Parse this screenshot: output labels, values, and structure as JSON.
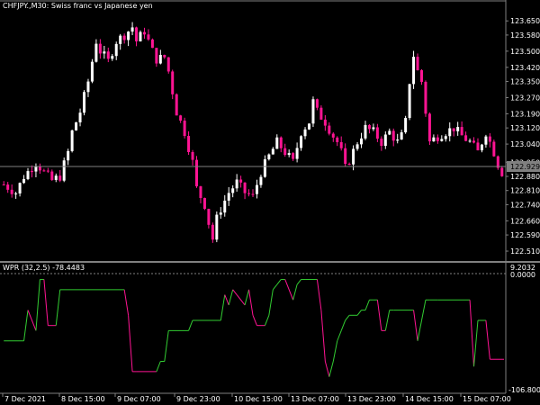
{
  "main_chart": {
    "header": "CHFJPY.,M30:  Swiss franc vs Japanese yen",
    "y_ticks": [
      "123.650",
      "123.580",
      "123.500",
      "123.420",
      "123.350",
      "123.270",
      "123.190",
      "123.120",
      "123.040",
      "122.950",
      "122.880",
      "122.810",
      "122.740",
      "122.660",
      "122.590",
      "122.510"
    ],
    "y_tick_values": [
      123.65,
      123.58,
      123.5,
      123.42,
      123.35,
      123.27,
      123.19,
      123.12,
      123.04,
      122.95,
      122.88,
      122.81,
      122.74,
      122.66,
      122.59,
      122.51
    ],
    "price_label": "122.929",
    "price_value": 122.929
  },
  "indicator": {
    "header": "WPR (32,2.5) -78.4483",
    "max_label": "9.2032",
    "level_label": "0.0000",
    "min_label": "-106.8001",
    "y_range": [
      -106.8001,
      9.2032
    ]
  },
  "x_ticks": [
    "7 Dec 2021",
    "8 Dec 15:00",
    "9 Dec 07:00",
    "9 Dec 23:00",
    "10 Dec 15:00",
    "13 Dec 07:00",
    "13 Dec 23:00",
    "14 Dec 15:00",
    "15 Dec 07:00"
  ],
  "colors": {
    "background": "#000000",
    "text": "#ffffff",
    "axis": "#808080",
    "bull_candle": "#ffffff",
    "bear_candle": "#ff1493",
    "wpr_up": "#32cd32",
    "wpr_down": "#ff1493"
  },
  "chart_data": [
    {
      "type": "candlestick",
      "title": "CHFJPY.,M30:  Swiss franc vs Japanese yen",
      "ylim": [
        122.47,
        123.7
      ],
      "current_price": 122.929,
      "close_path": [
        [
          0,
          122.84
        ],
        [
          3,
          122.8
        ],
        [
          5,
          122.88
        ],
        [
          8,
          122.95
        ],
        [
          10,
          122.9
        ],
        [
          12,
          122.86
        ],
        [
          14,
          122.88
        ],
        [
          16,
          123.0
        ],
        [
          17,
          123.1
        ],
        [
          19,
          123.2
        ],
        [
          21,
          123.35
        ],
        [
          23,
          123.55
        ],
        [
          24,
          123.5
        ],
        [
          26,
          123.45
        ],
        [
          28,
          123.55
        ],
        [
          30,
          123.58
        ],
        [
          32,
          123.62
        ],
        [
          33,
          123.55
        ],
        [
          35,
          123.6
        ],
        [
          37,
          123.5
        ],
        [
          38,
          123.46
        ],
        [
          40,
          123.47
        ],
        [
          41,
          123.4
        ],
        [
          43,
          123.2
        ],
        [
          45,
          123.1
        ],
        [
          47,
          122.95
        ],
        [
          48,
          122.82
        ],
        [
          50,
          122.74
        ],
        [
          51,
          122.65
        ],
        [
          52,
          122.57
        ],
        [
          53,
          122.67
        ],
        [
          54,
          122.72
        ],
        [
          56,
          122.8
        ],
        [
          58,
          122.85
        ],
        [
          60,
          122.8
        ],
        [
          62,
          122.78
        ],
        [
          63,
          122.84
        ],
        [
          64,
          122.9
        ],
        [
          66,
          122.98
        ],
        [
          68,
          123.05
        ],
        [
          70,
          123.0
        ],
        [
          72,
          122.95
        ],
        [
          74,
          123.1
        ],
        [
          76,
          123.15
        ],
        [
          77,
          123.25
        ],
        [
          78,
          123.2
        ],
        [
          80,
          123.15
        ],
        [
          82,
          123.08
        ],
        [
          83,
          123.05
        ],
        [
          84,
          123.0
        ],
        [
          85,
          122.92
        ],
        [
          86,
          122.96
        ],
        [
          88,
          123.05
        ],
        [
          90,
          123.12
        ],
        [
          92,
          123.1
        ],
        [
          94,
          123.05
        ],
        [
          96,
          123.1
        ],
        [
          98,
          123.05
        ],
        [
          99,
          123.08
        ],
        [
          100,
          123.15
        ],
        [
          101,
          123.35
        ],
        [
          102,
          123.48
        ],
        [
          103,
          123.4
        ],
        [
          104,
          123.35
        ],
        [
          105,
          123.2
        ],
        [
          106,
          123.05
        ],
        [
          108,
          123.08
        ],
        [
          110,
          123.1
        ],
        [
          112,
          123.12
        ],
        [
          114,
          123.08
        ],
        [
          116,
          123.05
        ],
        [
          118,
          123.0
        ],
        [
          120,
          123.1
        ],
        [
          121,
          123.05
        ],
        [
          122,
          123.0
        ],
        [
          123,
          122.94
        ],
        [
          124,
          122.9
        ]
      ]
    },
    {
      "type": "line",
      "title": "WPR (32,2.5) -78.4483",
      "ylim": [
        -106.8001,
        9.2032
      ],
      "x": [
        0,
        5,
        6,
        8,
        9,
        10,
        11,
        13,
        14,
        30,
        31,
        32,
        33,
        38,
        39,
        40,
        41,
        46,
        47,
        48,
        54,
        55,
        56,
        57,
        58,
        60,
        61,
        62,
        63,
        65,
        66,
        67,
        68,
        69,
        70,
        72,
        73,
        74,
        75,
        78,
        79,
        80,
        81,
        82,
        83,
        84,
        85,
        86,
        88,
        89,
        90,
        91,
        92,
        93,
        94,
        95,
        96,
        97,
        102,
        103,
        104,
        105,
        106,
        108,
        116,
        117,
        118,
        120,
        121
      ],
      "values": [
        -60,
        -60,
        -30,
        -50,
        0,
        0,
        -45,
        -45,
        -10,
        -10,
        -35,
        -90,
        -90,
        -90,
        -80,
        -80,
        -50,
        -50,
        -40,
        -40,
        -40,
        -15,
        -25,
        -10,
        -15,
        -25,
        -10,
        -35,
        -45,
        -45,
        -35,
        -10,
        -5,
        0,
        0,
        -20,
        -5,
        0,
        0,
        0,
        -30,
        -80,
        -95,
        -80,
        -60,
        -50,
        -40,
        -35,
        -35,
        -30,
        -30,
        -20,
        -20,
        -20,
        -50,
        -50,
        -30,
        -30,
        -30,
        -60,
        -40,
        -20,
        -20,
        -20,
        -20,
        -85,
        -40,
        -40,
        -78
      ]
    }
  ]
}
